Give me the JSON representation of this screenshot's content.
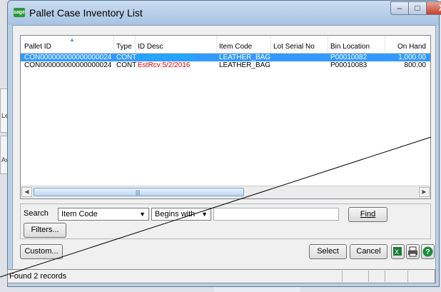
{
  "background": {
    "fragment_1": "Le",
    "fragment_2": "Av"
  },
  "window": {
    "app_icon": "sage",
    "title": "Pallet Case Inventory List",
    "min_glyph": "–",
    "max_glyph": "□",
    "close_glyph": "X"
  },
  "grid": {
    "columns": [
      "Pallet ID",
      "Type",
      "ID Desc",
      "Item Code",
      "Lot Serial No",
      "Bin Location",
      "On Hand"
    ],
    "rows": [
      {
        "pallet_id": "CON000000000000000024",
        "type": "CONT",
        "id_desc": "EstRcv:4/24/2016",
        "item_code": "LEATHER_BAG",
        "lot_serial": "",
        "bin": "P00010082",
        "on_hand": "1,000.00",
        "selected": true
      },
      {
        "pallet_id": "CON000000000000000024",
        "type": "CONT",
        "id_desc": "EstRcv:5/2/2016",
        "item_code": "LEATHER_BAG",
        "lot_serial": "",
        "bin": "P00010083",
        "on_hand": "800.00",
        "selected": false
      }
    ],
    "id_desc_color_selected": "#00c0ff",
    "id_desc_color": "#e00000",
    "selection_color": "#3399ff"
  },
  "search": {
    "label": "Search",
    "field_value": "Item Code",
    "operator_value": "Begins with",
    "text_value": "",
    "find_label": "Find",
    "filters_label": "Filters..."
  },
  "footer": {
    "custom_label": "Custom...",
    "select_label": "Select",
    "cancel_label": "Cancel"
  },
  "status": {
    "text": "Found 2 records"
  }
}
